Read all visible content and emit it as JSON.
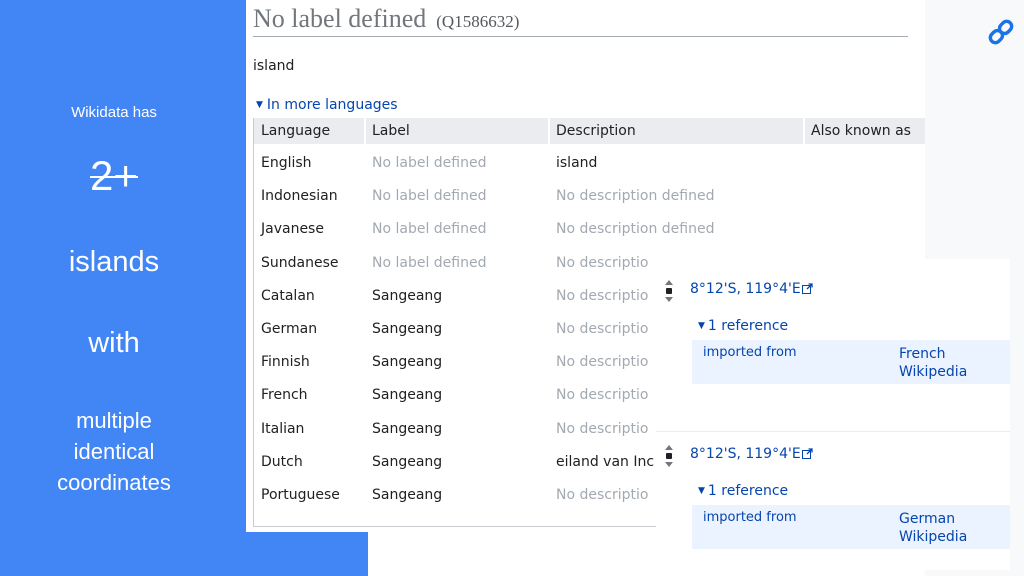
{
  "slide": {
    "intro": "Wikidata has",
    "count": "2+",
    "subject": "islands",
    "connector": "with",
    "detail": "multiple\nidentical\ncoordinates"
  },
  "wikidata": {
    "label": "No label defined",
    "qid": "(Q1586632)",
    "description": "island",
    "more_languages_label": "In more languages",
    "table": {
      "headers": [
        "Language",
        "Label",
        "Description",
        "Also known as"
      ],
      "rows": [
        {
          "language": "English",
          "label": "No label defined",
          "label_missing": true,
          "description": "island",
          "description_missing": false
        },
        {
          "language": "Indonesian",
          "label": "No label defined",
          "label_missing": true,
          "description": "No description defined",
          "description_missing": true
        },
        {
          "language": "Javanese",
          "label": "No label defined",
          "label_missing": true,
          "description": "No description defined",
          "description_missing": true
        },
        {
          "language": "Sundanese",
          "label": "No label defined",
          "label_missing": true,
          "description": "No descriptio",
          "description_missing": true
        },
        {
          "language": "Catalan",
          "label": "Sangeang",
          "label_missing": false,
          "description": "No descriptio",
          "description_missing": true
        },
        {
          "language": "German",
          "label": "Sangeang",
          "label_missing": false,
          "description": "No descriptio",
          "description_missing": true
        },
        {
          "language": "Finnish",
          "label": "Sangeang",
          "label_missing": false,
          "description": "No descriptio",
          "description_missing": true
        },
        {
          "language": "French",
          "label": "Sangeang",
          "label_missing": false,
          "description": "No descriptio",
          "description_missing": true
        },
        {
          "language": "Italian",
          "label": "Sangeang",
          "label_missing": false,
          "description": "No descriptio",
          "description_missing": true
        },
        {
          "language": "Dutch",
          "label": "Sangeang",
          "label_missing": false,
          "description": "eiland van Inc",
          "description_missing": false
        },
        {
          "language": "Portuguese",
          "label": "Sangeang",
          "label_missing": false,
          "description": "No descriptio",
          "description_missing": true
        }
      ]
    }
  },
  "statements": [
    {
      "coordinate": "8°12'S, 119°4'E",
      "references_toggle": "1 reference",
      "ref_property": "imported from",
      "ref_value": "French\nWikipedia"
    },
    {
      "coordinate": "8°12'S, 119°4'E",
      "references_toggle": "1 reference",
      "ref_property": "imported from",
      "ref_value": "German\nWikipedia"
    }
  ],
  "icons": {
    "share": "link-icon",
    "rank": "normal-rank-icon",
    "external": "external-link-icon",
    "toggle": "triangle-down-icon"
  },
  "colors": {
    "slide_blue": "#4285f4",
    "link_blue": "#0645ad",
    "muted_gray": "#a2a9b1",
    "header_gray": "#eaecf0",
    "reference_bg": "#eaf3ff"
  }
}
